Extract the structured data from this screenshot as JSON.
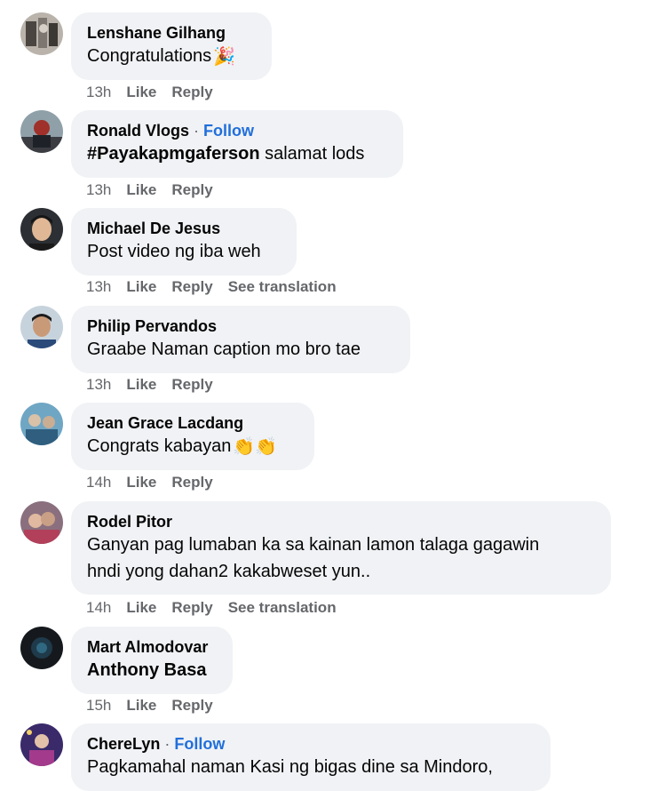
{
  "comments": [
    {
      "author": "Lenshane Gilhang",
      "text": "Congratulations",
      "emoji": "party-popper",
      "time": "13h",
      "like": "Like",
      "reply": "Reply"
    },
    {
      "author": "Ronald Vlogs",
      "follow": "Follow",
      "follow_separator": "·",
      "hashtag": "#Payakapmgaferson",
      "text": "salamat lods",
      "time": "13h",
      "like": "Like",
      "reply": "Reply"
    },
    {
      "author": "Michael De Jesus",
      "text": "Post video ng iba weh",
      "time": "13h",
      "like": "Like",
      "reply": "Reply",
      "see_translation": "See translation"
    },
    {
      "author": "Philip Pervandos",
      "text": "Graabe Naman caption mo bro tae",
      "time": "13h",
      "like": "Like",
      "reply": "Reply"
    },
    {
      "author": "Jean Grace Lacdang",
      "text": "Congrats kabayan",
      "emoji": "clapping-hands",
      "time": "14h",
      "like": "Like",
      "reply": "Reply"
    },
    {
      "author": "Rodel Pitor",
      "text_line1": "Ganyan pag lumaban ka sa kainan lamon talaga gagawin",
      "text_line2": "hndi yong dahan2 kakabweset yun..",
      "time": "14h",
      "like": "Like",
      "reply": "Reply",
      "see_translation": "See translation"
    },
    {
      "author": "Mart Almodovar",
      "mention": "Anthony Basa",
      "time": "15h",
      "like": "Like",
      "reply": "Reply"
    },
    {
      "author": "ChereLyn",
      "follow": "Follow",
      "follow_separator": "·",
      "text": "Pagkamahal naman Kasi ng bigas dine sa Mindoro,"
    }
  ],
  "colors": {
    "bubble": "#f0f2f5",
    "meta": "#65676b",
    "link": "#216fdb",
    "text": "#050505"
  }
}
